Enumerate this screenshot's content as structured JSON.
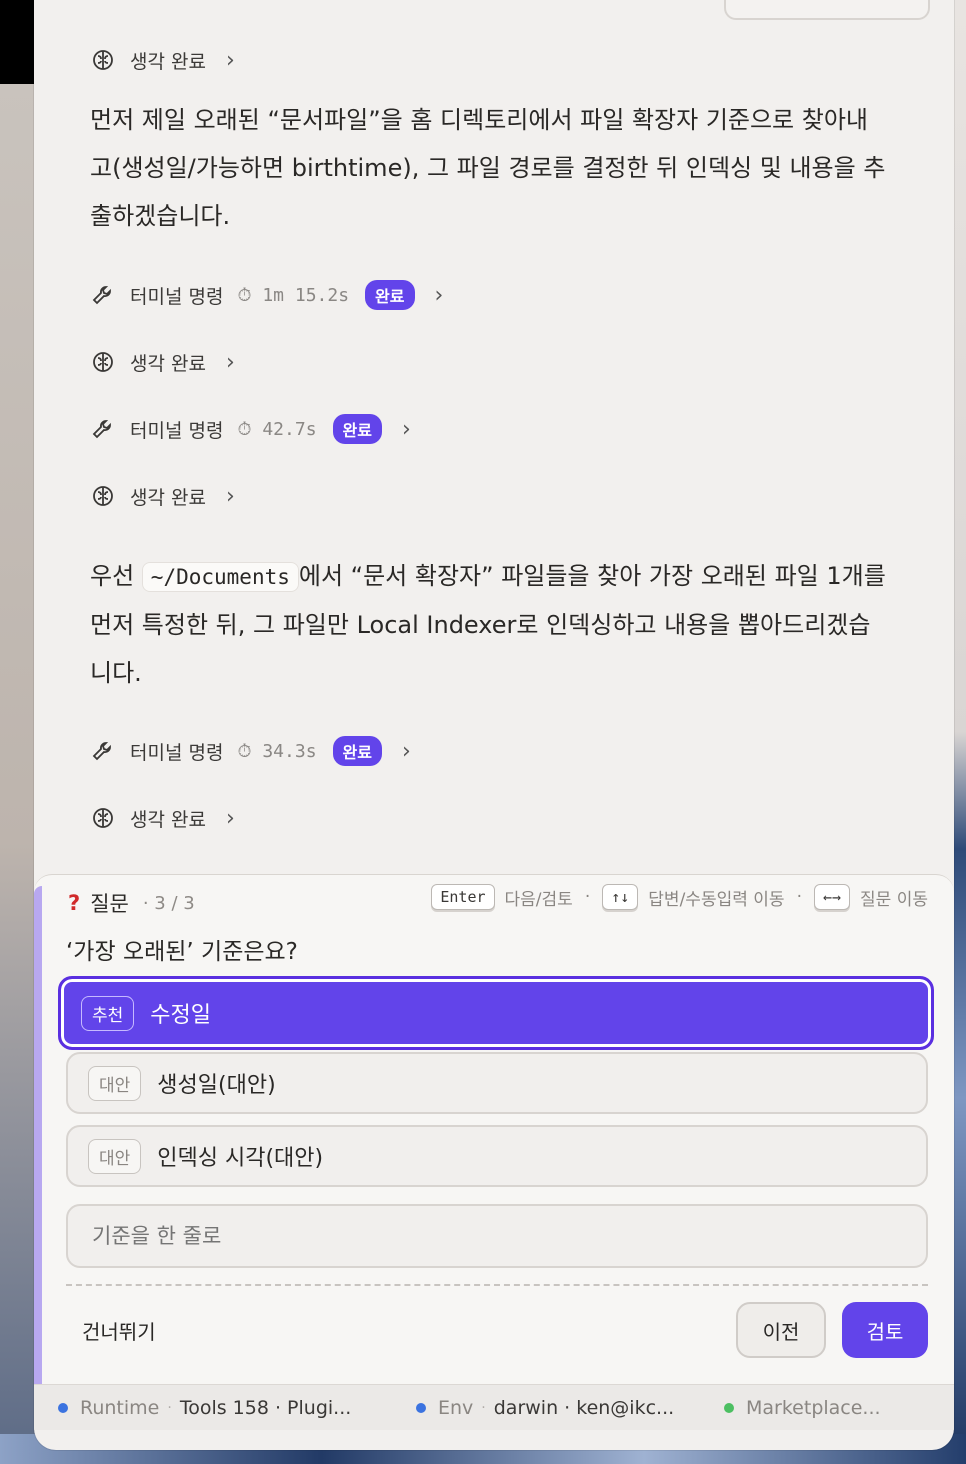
{
  "colors": {
    "accent": "#6244ea",
    "runtime_dot": "#3b73e0",
    "env_dot": "#3b73e0",
    "marketplace_dot": "#4cbf62"
  },
  "chat": {
    "thought_label": "생각 완료",
    "terminal_label": "터미널 명령",
    "done_badge": "완료",
    "para1": "먼저 제일 오래된 “문서파일”을 홈 디렉토리에서 파일 확장자 기준으로 찾아내고(생성일/가능하면 birthtime), 그 파일 경로를 결정한 뒤 인덱싱 및 내용을 추출하겠습니다.",
    "terminal1_time": "1m 15.2s",
    "terminal2_time": "42.7s",
    "para2_before": "우선 ",
    "para2_code": "~/Documents",
    "para2_after": "에서 “문서 확장자” 파일들을 찾아 가장 오래된 파일 1개를 먼저 특정한 뒤, 그 파일만 Local Indexer로 인덱싱하고 내용을 뽑아드리겠습니다.",
    "terminal3_time": "34.3s"
  },
  "question": {
    "mark": "?",
    "label": "질문",
    "count": "· 3 / 3",
    "title": "‘가장 오래된’ 기준은요?",
    "hints": [
      {
        "key": "Enter",
        "text": "다음/검토"
      },
      {
        "key": "↑↓",
        "text": "답변/수동입력 이동"
      },
      {
        "key": "←→",
        "text": "질문 이동"
      }
    ],
    "options": [
      {
        "tag": "추천",
        "text": "수정일"
      },
      {
        "tag": "대안",
        "text": "생성일(대안)"
      },
      {
        "tag": "대안",
        "text": "인덱싱 시각(대안)"
      }
    ],
    "input_placeholder": "기준을 한 줄로",
    "skip": "건너뛰기",
    "prev": "이전",
    "review": "검토"
  },
  "statusbar": {
    "runtime_label": "Runtime",
    "runtime_value": "Tools 158 · Plugi...",
    "env_label": "Env",
    "env_value": "darwin · ken@ikc...",
    "marketplace_label": "Marketplace..."
  }
}
